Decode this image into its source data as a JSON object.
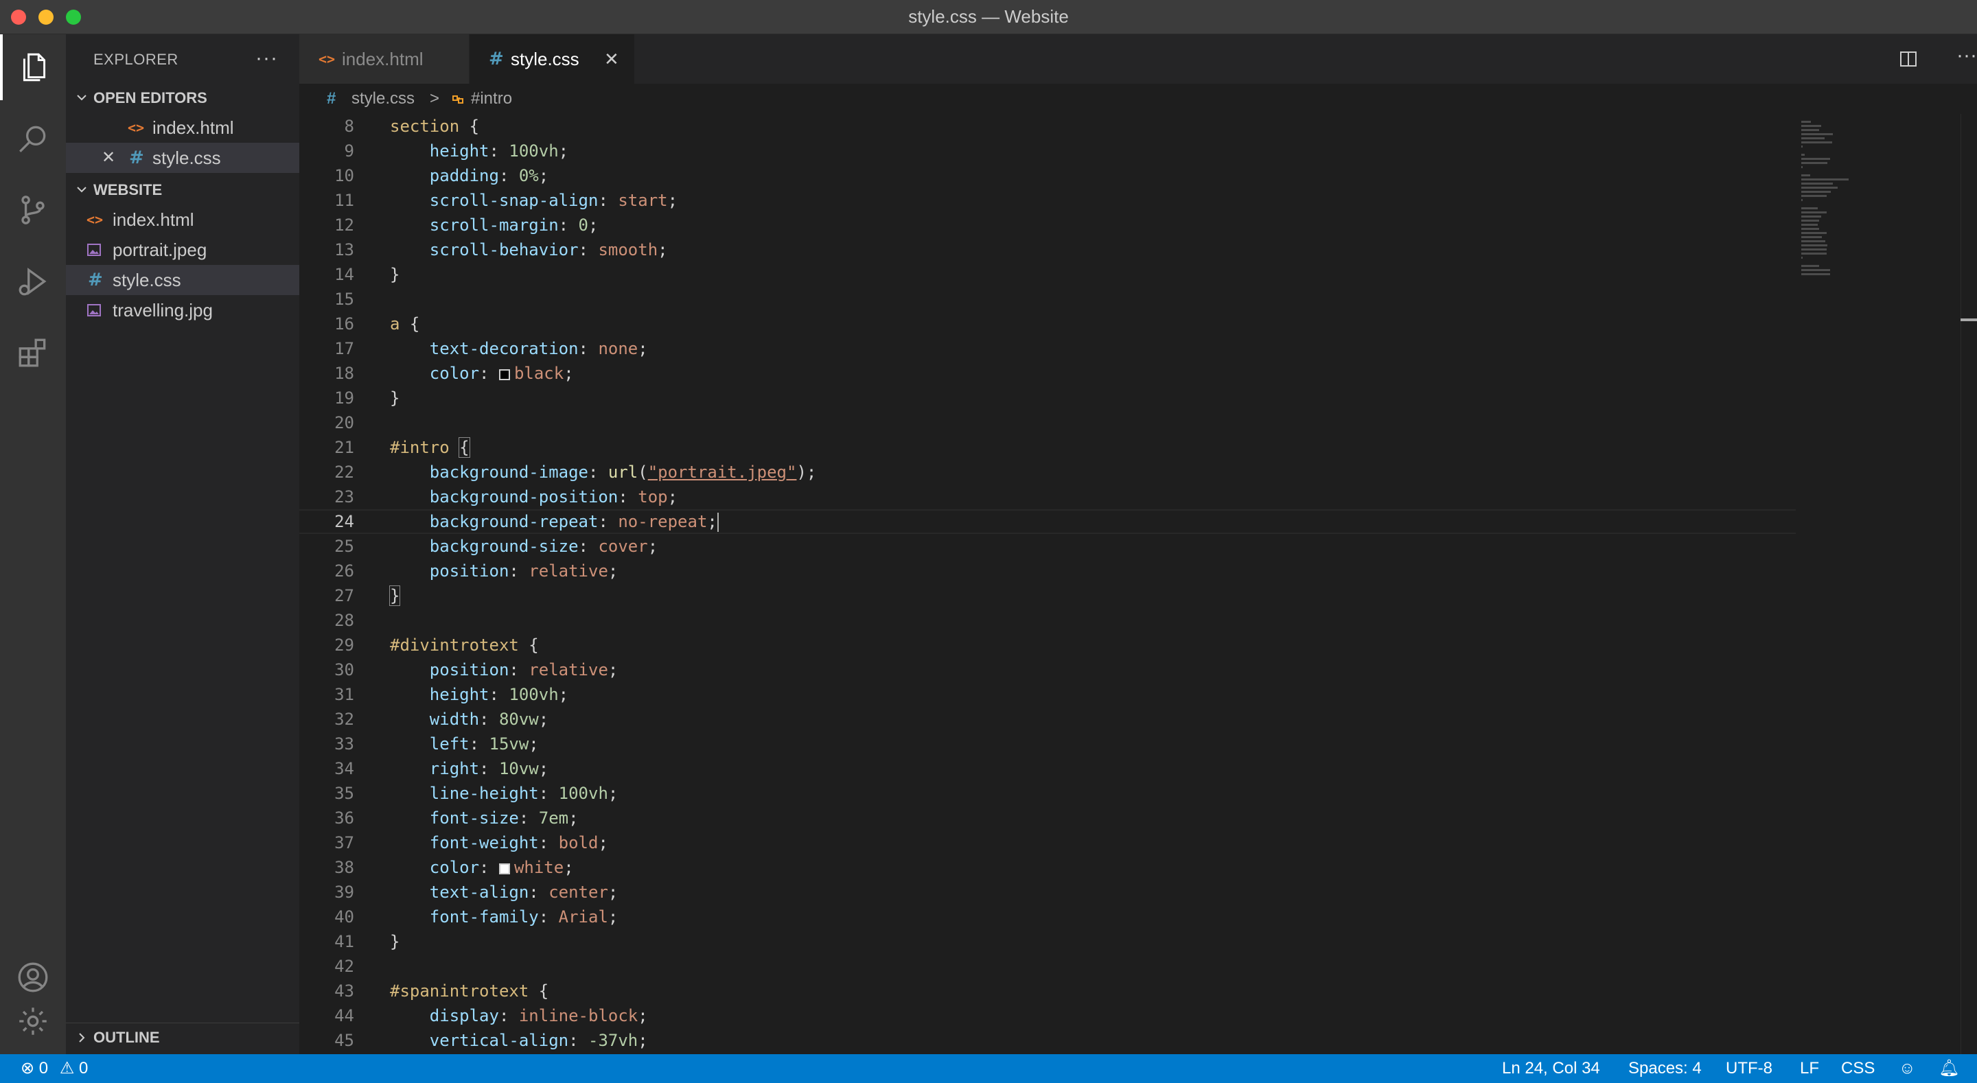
{
  "window": {
    "title": "style.css — Website"
  },
  "sidebar": {
    "title": "EXPLORER",
    "more": "···",
    "open_editors": {
      "label": "OPEN EDITORS",
      "items": [
        {
          "name": "index.html",
          "icon": "html-icon"
        },
        {
          "name": "style.css",
          "icon": "css-icon",
          "close": "✕"
        }
      ]
    },
    "website": {
      "label": "WEBSITE",
      "items": [
        {
          "name": "index.html",
          "icon": "html-icon"
        },
        {
          "name": "portrait.jpeg",
          "icon": "image-icon"
        },
        {
          "name": "style.css",
          "icon": "css-icon",
          "selected": true
        },
        {
          "name": "travelling.jpg",
          "icon": "image-icon"
        }
      ]
    },
    "outline": {
      "label": "OUTLINE"
    }
  },
  "tabs": [
    {
      "label": "index.html",
      "active": false
    },
    {
      "label": "style.css",
      "active": true,
      "close": "✕"
    }
  ],
  "breadcrumb": {
    "file": "style.css",
    "separator": ">",
    "symbol": "#intro"
  },
  "editor": {
    "lines": [
      {
        "n": "8",
        "tokens": [
          [
            "sel",
            "section"
          ],
          [
            "punc",
            " {"
          ]
        ]
      },
      {
        "n": "9",
        "tokens": [
          [
            "punc",
            "    "
          ],
          [
            "prop",
            "height"
          ],
          [
            "punc",
            ": "
          ],
          [
            "num",
            "100vh"
          ],
          [
            "punc",
            ";"
          ]
        ]
      },
      {
        "n": "10",
        "tokens": [
          [
            "punc",
            "    "
          ],
          [
            "prop",
            "padding"
          ],
          [
            "punc",
            ": "
          ],
          [
            "num",
            "0%"
          ],
          [
            "punc",
            ";"
          ]
        ]
      },
      {
        "n": "11",
        "tokens": [
          [
            "punc",
            "    "
          ],
          [
            "prop",
            "scroll-snap-align"
          ],
          [
            "punc",
            ": "
          ],
          [
            "val",
            "start"
          ],
          [
            "punc",
            ";"
          ]
        ]
      },
      {
        "n": "12",
        "tokens": [
          [
            "punc",
            "    "
          ],
          [
            "prop",
            "scroll-margin"
          ],
          [
            "punc",
            ": "
          ],
          [
            "num",
            "0"
          ],
          [
            "punc",
            ";"
          ]
        ]
      },
      {
        "n": "13",
        "tokens": [
          [
            "punc",
            "    "
          ],
          [
            "prop",
            "scroll-behavior"
          ],
          [
            "punc",
            ": "
          ],
          [
            "val",
            "smooth"
          ],
          [
            "punc",
            ";"
          ]
        ]
      },
      {
        "n": "14",
        "tokens": [
          [
            "punc",
            "}"
          ]
        ]
      },
      {
        "n": "15",
        "tokens": []
      },
      {
        "n": "16",
        "tokens": [
          [
            "sel",
            "a"
          ],
          [
            "punc",
            " {"
          ]
        ]
      },
      {
        "n": "17",
        "tokens": [
          [
            "punc",
            "    "
          ],
          [
            "prop",
            "text-decoration"
          ],
          [
            "punc",
            ": "
          ],
          [
            "val",
            "none"
          ],
          [
            "punc",
            ";"
          ]
        ]
      },
      {
        "n": "18",
        "tokens": [
          [
            "punc",
            "    "
          ],
          [
            "prop",
            "color"
          ],
          [
            "punc",
            ": "
          ],
          [
            "swatch",
            "#000000"
          ],
          [
            "val",
            "black"
          ],
          [
            "punc",
            ";"
          ]
        ]
      },
      {
        "n": "19",
        "tokens": [
          [
            "punc",
            "}"
          ]
        ]
      },
      {
        "n": "20",
        "tokens": []
      },
      {
        "n": "21",
        "tokens": [
          [
            "sel",
            "#intro"
          ],
          [
            "punc",
            " "
          ],
          [
            "bracket",
            "{"
          ]
        ]
      },
      {
        "n": "22",
        "tokens": [
          [
            "punc",
            "    "
          ],
          [
            "prop",
            "background-image"
          ],
          [
            "punc",
            ": "
          ],
          [
            "fn",
            "url"
          ],
          [
            "punc",
            "("
          ],
          [
            "str",
            "\"portrait.jpeg\""
          ],
          [
            "punc",
            ");"
          ]
        ]
      },
      {
        "n": "23",
        "tokens": [
          [
            "punc",
            "    "
          ],
          [
            "prop",
            "background-position"
          ],
          [
            "punc",
            ": "
          ],
          [
            "val",
            "top"
          ],
          [
            "punc",
            ";"
          ]
        ]
      },
      {
        "n": "24",
        "current": true,
        "tokens": [
          [
            "punc",
            "    "
          ],
          [
            "prop",
            "background-repeat"
          ],
          [
            "punc",
            ": "
          ],
          [
            "val",
            "no-repeat"
          ],
          [
            "punc",
            ";"
          ],
          [
            "cursor",
            ""
          ]
        ]
      },
      {
        "n": "25",
        "tokens": [
          [
            "punc",
            "    "
          ],
          [
            "prop",
            "background-size"
          ],
          [
            "punc",
            ": "
          ],
          [
            "val",
            "cover"
          ],
          [
            "punc",
            ";"
          ]
        ]
      },
      {
        "n": "26",
        "tokens": [
          [
            "punc",
            "    "
          ],
          [
            "prop",
            "position"
          ],
          [
            "punc",
            ": "
          ],
          [
            "val",
            "relative"
          ],
          [
            "punc",
            ";"
          ]
        ]
      },
      {
        "n": "27",
        "tokens": [
          [
            "bracket",
            "}"
          ]
        ]
      },
      {
        "n": "28",
        "tokens": []
      },
      {
        "n": "29",
        "tokens": [
          [
            "sel",
            "#divintrotext"
          ],
          [
            "punc",
            " {"
          ]
        ]
      },
      {
        "n": "30",
        "tokens": [
          [
            "punc",
            "    "
          ],
          [
            "prop",
            "position"
          ],
          [
            "punc",
            ": "
          ],
          [
            "val",
            "relative"
          ],
          [
            "punc",
            ";"
          ]
        ]
      },
      {
        "n": "31",
        "tokens": [
          [
            "punc",
            "    "
          ],
          [
            "prop",
            "height"
          ],
          [
            "punc",
            ": "
          ],
          [
            "num",
            "100vh"
          ],
          [
            "punc",
            ";"
          ]
        ]
      },
      {
        "n": "32",
        "tokens": [
          [
            "punc",
            "    "
          ],
          [
            "prop",
            "width"
          ],
          [
            "punc",
            ": "
          ],
          [
            "num",
            "80vw"
          ],
          [
            "punc",
            ";"
          ]
        ]
      },
      {
        "n": "33",
        "tokens": [
          [
            "punc",
            "    "
          ],
          [
            "prop",
            "left"
          ],
          [
            "punc",
            ": "
          ],
          [
            "num",
            "15vw"
          ],
          [
            "punc",
            ";"
          ]
        ]
      },
      {
        "n": "34",
        "tokens": [
          [
            "punc",
            "    "
          ],
          [
            "prop",
            "right"
          ],
          [
            "punc",
            ": "
          ],
          [
            "num",
            "10vw"
          ],
          [
            "punc",
            ";"
          ]
        ]
      },
      {
        "n": "35",
        "tokens": [
          [
            "punc",
            "    "
          ],
          [
            "prop",
            "line-height"
          ],
          [
            "punc",
            ": "
          ],
          [
            "num",
            "100vh"
          ],
          [
            "punc",
            ";"
          ]
        ]
      },
      {
        "n": "36",
        "tokens": [
          [
            "punc",
            "    "
          ],
          [
            "prop",
            "font-size"
          ],
          [
            "punc",
            ": "
          ],
          [
            "num",
            "7em"
          ],
          [
            "punc",
            ";"
          ]
        ]
      },
      {
        "n": "37",
        "tokens": [
          [
            "punc",
            "    "
          ],
          [
            "prop",
            "font-weight"
          ],
          [
            "punc",
            ": "
          ],
          [
            "val",
            "bold"
          ],
          [
            "punc",
            ";"
          ]
        ]
      },
      {
        "n": "38",
        "tokens": [
          [
            "punc",
            "    "
          ],
          [
            "prop",
            "color"
          ],
          [
            "punc",
            ": "
          ],
          [
            "swatch",
            "#ffffff"
          ],
          [
            "val",
            "white"
          ],
          [
            "punc",
            ";"
          ]
        ]
      },
      {
        "n": "39",
        "tokens": [
          [
            "punc",
            "    "
          ],
          [
            "prop",
            "text-align"
          ],
          [
            "punc",
            ": "
          ],
          [
            "val",
            "center"
          ],
          [
            "punc",
            ";"
          ]
        ]
      },
      {
        "n": "40",
        "tokens": [
          [
            "punc",
            "    "
          ],
          [
            "prop",
            "font-family"
          ],
          [
            "punc",
            ": "
          ],
          [
            "val",
            "Arial"
          ],
          [
            "punc",
            ";"
          ]
        ]
      },
      {
        "n": "41",
        "tokens": [
          [
            "punc",
            "}"
          ]
        ]
      },
      {
        "n": "42",
        "tokens": []
      },
      {
        "n": "43",
        "tokens": [
          [
            "sel",
            "#spanintrotext"
          ],
          [
            "punc",
            " {"
          ]
        ]
      },
      {
        "n": "44",
        "tokens": [
          [
            "punc",
            "    "
          ],
          [
            "prop",
            "display"
          ],
          [
            "punc",
            ": "
          ],
          [
            "val",
            "inline-block"
          ],
          [
            "punc",
            ";"
          ]
        ]
      },
      {
        "n": "45",
        "tokens": [
          [
            "punc",
            "    "
          ],
          [
            "prop",
            "vertical-align"
          ],
          [
            "punc",
            ": "
          ],
          [
            "num",
            "-37vh"
          ],
          [
            "punc",
            ";"
          ]
        ]
      }
    ]
  },
  "statusbar": {
    "errors": "0",
    "warnings": "0",
    "position": "Ln 24, Col 34",
    "spaces": "Spaces: 4",
    "encoding": "UTF-8",
    "eol": "LF",
    "language": "CSS"
  },
  "colors": {
    "accent": "#007acc",
    "editor_bg": "#1e1e1e",
    "sidebar_bg": "#252526"
  }
}
